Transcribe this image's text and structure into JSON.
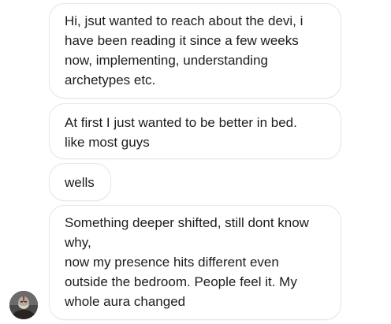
{
  "messages": [
    {
      "text": "Hi, jsut wanted to reach about the devi, i\nhave been reading it since a few weeks\nnow, implementing, understanding\narchetypes etc."
    },
    {
      "text": "At first I just wanted to be better in bed.\nlike most guys"
    },
    {
      "text": "wells"
    },
    {
      "text": "Something deeper shifted, still dont know\nwhy,\nnow my presence hits different even\noutside the bedroom. People feel it. My\nwhole aura changed"
    }
  ],
  "sender": {
    "avatar_icon": "user-avatar-icon"
  }
}
